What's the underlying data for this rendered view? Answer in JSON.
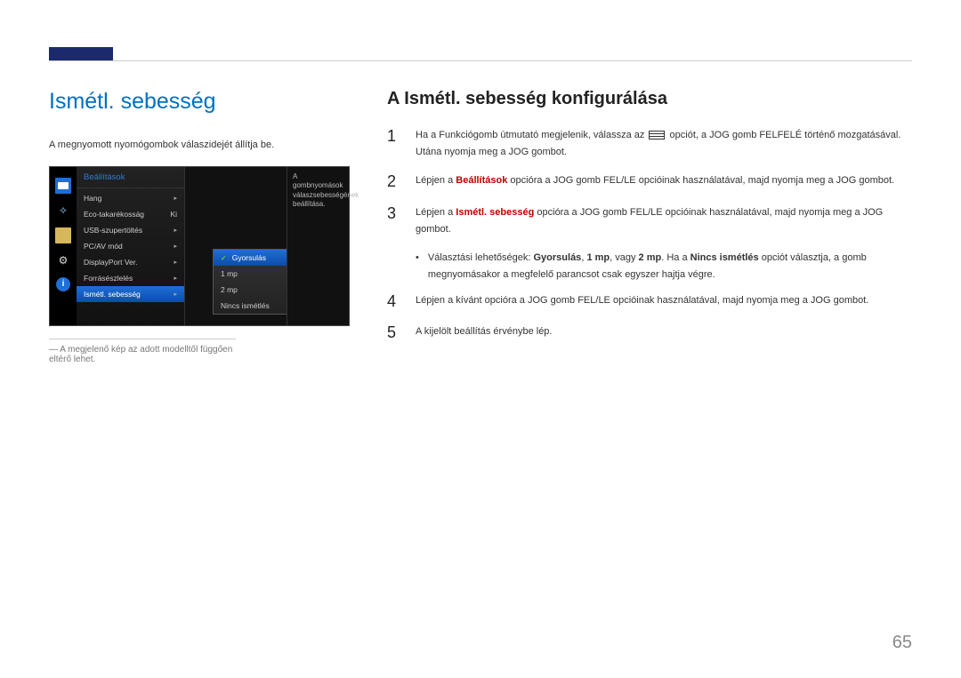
{
  "page": {
    "title": "Ismétl. sebesség",
    "subtitle": "A megnyomott nyomógombok válaszidejét állítja be.",
    "caption": "A megjelenő kép az adott modelltől függően eltérő lehet.",
    "number": "65"
  },
  "osd": {
    "header": "Beállítások",
    "items": [
      {
        "label": "Hang",
        "value": "",
        "arrow": true
      },
      {
        "label": "Eco-takarékosság",
        "value": "Ki"
      },
      {
        "label": "USB-szupertöltés",
        "value": "",
        "arrow": true
      },
      {
        "label": "PC/AV mód",
        "value": "",
        "arrow": true
      },
      {
        "label": "DisplayPort Ver.",
        "value": "",
        "arrow": true
      },
      {
        "label": "Forrásészlelés",
        "value": "",
        "arrow": true
      },
      {
        "label": "Ismétl. sebesség",
        "value": "",
        "arrow": true,
        "selected": true
      }
    ],
    "submenu": [
      {
        "label": "Gyorsulás",
        "selected": true
      },
      {
        "label": "1 mp"
      },
      {
        "label": "2 mp"
      },
      {
        "label": "Nincs ismétlés"
      }
    ],
    "description": "A gombnyomások válaszsebességének beállítása."
  },
  "right": {
    "title": "A Ismétl. sebesség konfigurálása",
    "steps": {
      "s1a": "Ha a Funkciógomb útmutató megjelenik, válassza az ",
      "s1b": " opciót, a JOG gomb FELFELÉ történő mozgatásával. Utána nyomja meg a JOG gombot.",
      "s2a": "Lépjen a ",
      "s2b": "Beállítások",
      "s2c": " opcióra a JOG gomb FEL/LE opcióinak használatával, majd nyomja meg a JOG gombot.",
      "s3a": "Lépjen a ",
      "s3b": "Ismétl. sebesség",
      "s3c": " opcióra a JOG gomb FEL/LE opcióinak használatával, majd nyomja meg a JOG gombot.",
      "bulleta": "Választási lehetőségek: ",
      "bulletb": "Gyorsulás",
      "bulletc": ", ",
      "bulletd": "1 mp",
      "bullete": ", vagy ",
      "bulletf": "2 mp",
      "bulletg": ". Ha a ",
      "bulleth": "Nincs ismétlés",
      "bulleti": " opciót választja, a gomb megnyomásakor a megfelelő parancsot csak egyszer hajtja végre.",
      "s4": "Lépjen a kívánt opcióra a JOG gomb FEL/LE opcióinak használatával, majd nyomja meg a JOG gombot.",
      "s5": "A kijelölt beállítás érvénybe lép."
    }
  }
}
